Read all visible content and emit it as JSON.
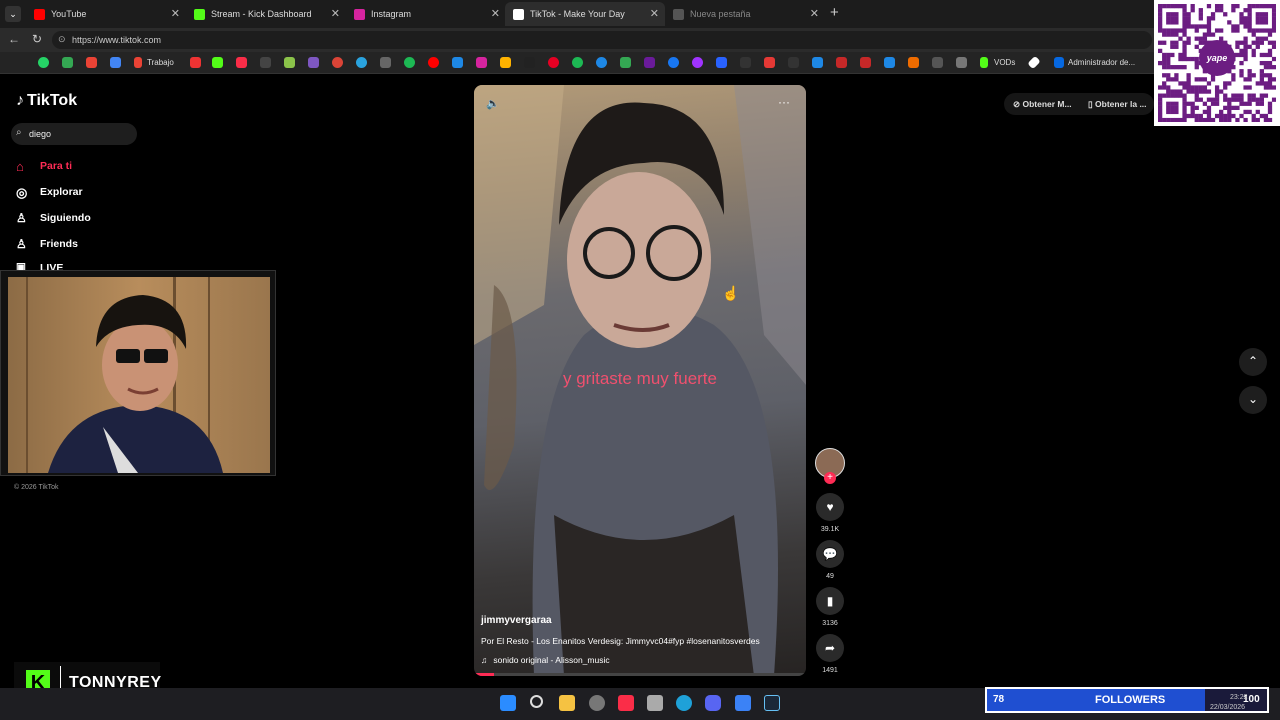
{
  "browser": {
    "tabs": [
      {
        "title": "YouTube",
        "color": "#ff0000"
      },
      {
        "title": "Stream - Kick Dashboard",
        "color": "#53fc18"
      },
      {
        "title": "Instagram",
        "color": "#d6249f"
      },
      {
        "title": "TikTok - Make Your Day",
        "color": "#ffffff"
      },
      {
        "title": "Nueva pestaña",
        "color": "#666666"
      }
    ],
    "url": "https://www.tiktok.com",
    "bookmarks": {
      "trabajo": "Trabajo",
      "vods": "VODs",
      "admin": "Administrador de..."
    }
  },
  "tiktok": {
    "logo": "TikTok",
    "search_value": "diego",
    "nav": [
      {
        "label": "Para ti",
        "icon": "home-icon"
      },
      {
        "label": "Explorar",
        "icon": "compass-icon"
      },
      {
        "label": "Siguiendo",
        "icon": "following-icon"
      },
      {
        "label": "Friends",
        "icon": "friends-icon"
      },
      {
        "label": "LIVE",
        "icon": "live-icon"
      }
    ],
    "copyright": "© 2026 TikTok",
    "top_actions": [
      "Obtener M...",
      "Obtener la ..."
    ],
    "video": {
      "caption_overlay": "y gritaste muy fuerte",
      "username": "jimmyvergaraa",
      "description": "Por El Resto - Los Enanitos Verdesig:  Jimmyvc04#fyp #losenanitosverdes",
      "sound": "sonido original - Alisson_music"
    },
    "stats": {
      "likes": "39.1K",
      "comments": "49",
      "saves": "3136",
      "shares": "1491"
    }
  },
  "overlay": {
    "streamer": "TONNYREY",
    "followers_count": "78",
    "followers_label": "FOLLOWERS",
    "goal": "100",
    "qr_label": "yape"
  },
  "taskbar": {
    "time": "23:22",
    "date": "22/03/2026"
  }
}
